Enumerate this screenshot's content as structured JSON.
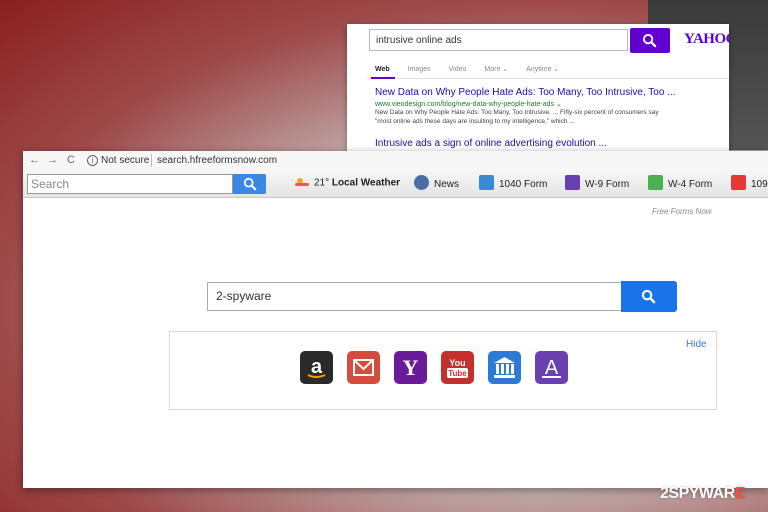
{
  "yahoo_window": {
    "search_value": "intrusive online ads",
    "logo": "YAHOO!",
    "tabs": [
      "Web",
      "Images",
      "Video",
      "More ⌄",
      "Anytime ⌄"
    ],
    "result1_title": "New Data on Why People Hate Ads: Too Many, Too Intrusive, Too ...",
    "result1_url": "www.vieodesign.com/blog/new-data-why-people-hate-ads ⌄",
    "result1_desc": "New Data on Why People Hate Ads: Too Many, Too Intrusive. ... Fifty-six percent of consumers say \"most online ads these days are insulting to my intelligence,\" which ...",
    "result2_title": "Intrusive ads a sign of online advertising evolution ..."
  },
  "browser": {
    "nav_back": "←",
    "nav_forward": "→",
    "nav_reload": "C",
    "info_icon": "i",
    "security_label": "Not secure",
    "url": "search.hfreeformsnow.com",
    "toolbar": {
      "search_placeholder": "Search",
      "weather_temp": "21°",
      "weather_label": "Local Weather",
      "items": [
        {
          "label": "News",
          "icon": "news-icon",
          "color": "#4a6fa5"
        },
        {
          "label": "1040 Form",
          "icon": "1040-form-icon",
          "color": "#3a8ad8"
        },
        {
          "label": "W-9 Form",
          "icon": "w9-form-icon",
          "color": "#6a3fb0"
        },
        {
          "label": "W-4 Form",
          "icon": "w4-form-icon",
          "color": "#4caf50"
        },
        {
          "label": "109",
          "icon": "1099-form-icon",
          "color": "#e53935"
        }
      ]
    },
    "brand": "Free Forms Now",
    "main_search_value": "2-spyware",
    "hide_label": "Hide",
    "tiles": [
      {
        "name": "amazon",
        "color": "#2a2a2a"
      },
      {
        "name": "gmail",
        "color": "#d54b3d"
      },
      {
        "name": "yahoo",
        "color": "#6a1b9a"
      },
      {
        "name": "youtube",
        "color": "#c4302b"
      },
      {
        "name": "irs",
        "color": "#2b7ad6"
      },
      {
        "name": "forms",
        "color": "#6a3fb0"
      }
    ]
  },
  "watermark": {
    "part1": "2SPYWAR",
    "part2": "E"
  }
}
